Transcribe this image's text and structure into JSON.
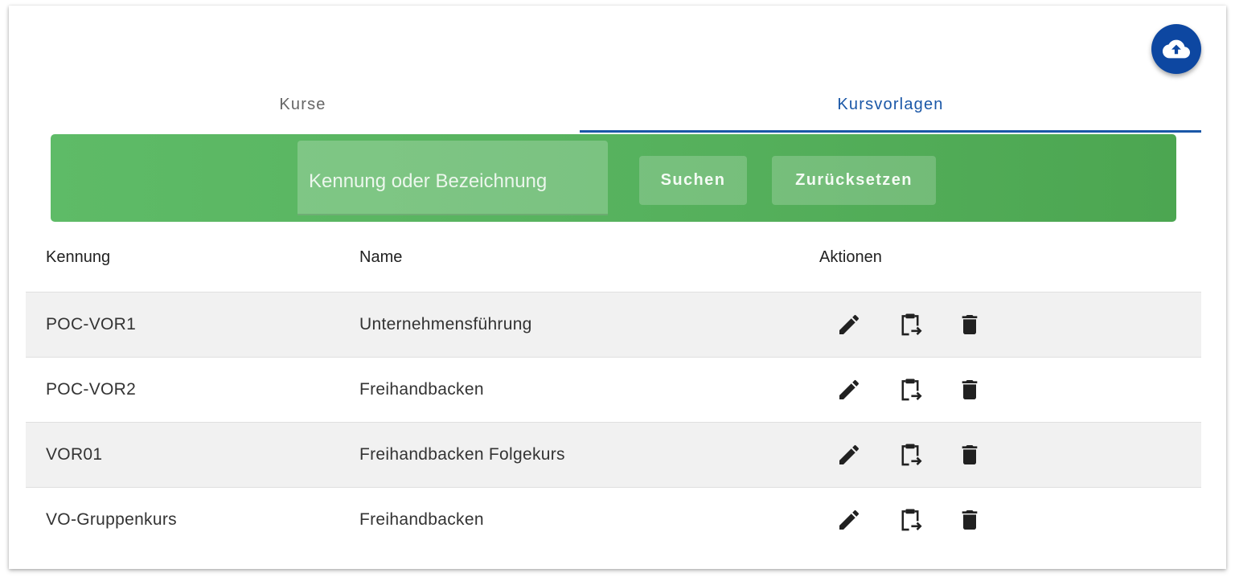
{
  "tabs": [
    {
      "label": "Kurse",
      "active": false
    },
    {
      "label": "Kursvorlagen",
      "active": true
    }
  ],
  "fab": {
    "icon": "cloud-upload-icon"
  },
  "search": {
    "placeholder": "Kennung oder Bezeichnung",
    "value": "",
    "search_label": "Suchen",
    "reset_label": "Zurücksetzen"
  },
  "table": {
    "columns": [
      "Kennung",
      "Name",
      "Aktionen"
    ],
    "rows": [
      {
        "id": "POC-VOR1",
        "name": "Unternehmensführung"
      },
      {
        "id": "POC-VOR2",
        "name": "Freihandbacken"
      },
      {
        "id": "VOR01",
        "name": "Freihandbacken Folgekurs"
      },
      {
        "id": "VO-Gruppenkurs",
        "name": "Freihandbacken"
      }
    ],
    "action_icons": [
      "edit-icon",
      "copy-to-course-icon",
      "delete-icon"
    ]
  },
  "colors": {
    "primary": "#1a57a7",
    "fab": "#0d47a1",
    "search_bar": "#56b15d",
    "row_stripe": "#f1f1f1"
  }
}
